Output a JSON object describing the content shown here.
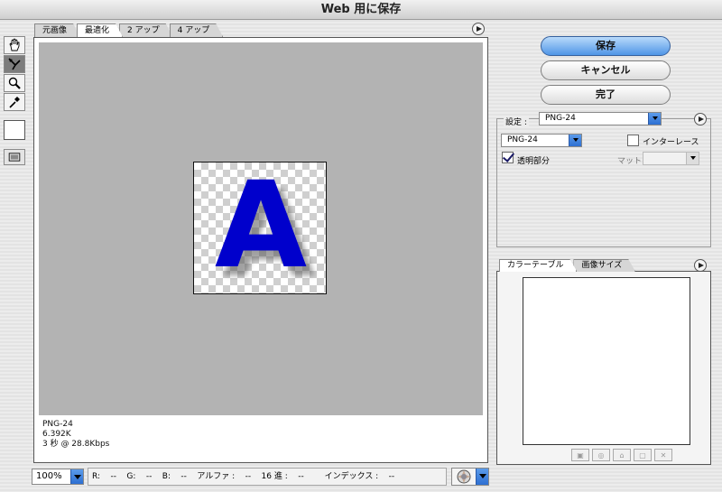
{
  "window": {
    "title": "Web 用に保存"
  },
  "view_tabs": [
    "元画像",
    "最適化",
    "2 アップ",
    "4 アップ"
  ],
  "tools": [
    "hand-icon",
    "slice-select-icon",
    "zoom-icon",
    "eyedropper-icon"
  ],
  "preview": {
    "letter": "A",
    "letter_color": "#0000cc"
  },
  "info": {
    "format": "PNG-24",
    "size": "6.392K",
    "time": "3 秒 @ 28.8Kbps"
  },
  "zoom": {
    "value": "100%"
  },
  "status": "R:    --    G:    --    B:    --    アルファ :    --    16 進 :    --        インデックス :    --",
  "buttons": {
    "save": "保存",
    "cancel": "キャンセル",
    "done": "完了"
  },
  "settings": {
    "label": "設定 :",
    "preset": "PNG-24",
    "format": "PNG-24",
    "interlace_label": "インターレース",
    "interlace_checked": false,
    "transparency_label": "透明部分",
    "transparency_checked": true,
    "matte_label": "マット :"
  },
  "color_table": {
    "tabs": [
      "カラーテーブル",
      "画像サイズ"
    ]
  },
  "colors": {
    "accent": "#4f95e6",
    "canvas": "#b3b3b3"
  }
}
